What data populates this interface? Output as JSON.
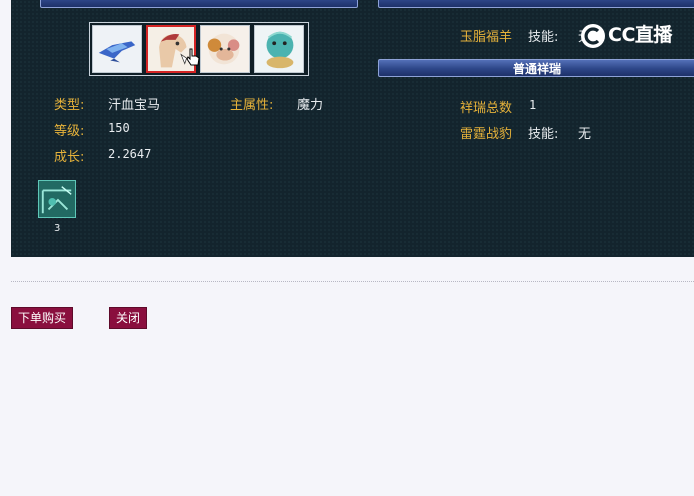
{
  "panels": {
    "top_left_banner": "",
    "top_right_banner": "",
    "normal_banner": "普通祥瑞"
  },
  "pets": [
    {
      "name": "pet-1",
      "selected": false
    },
    {
      "name": "pet-2",
      "selected": true
    },
    {
      "name": "pet-3",
      "selected": false
    },
    {
      "name": "pet-4",
      "selected": false
    }
  ],
  "stats": {
    "type_label": "类型:",
    "type_value": "汗血宝马",
    "attr_label": "主属性:",
    "attr_value": "魔力",
    "level_label": "等级:",
    "level_value": "150",
    "growth_label": "成长:",
    "growth_value": "2.2647"
  },
  "right": {
    "special_name": "玉脂福羊",
    "skill_label": "技能:",
    "special_skill": "无",
    "total_label": "祥瑞总数",
    "total_value": "1",
    "item_name": "雷霆战豹",
    "item_skill_label": "技能:",
    "item_skill": "无"
  },
  "item": {
    "count": "3",
    "icon": "tile-icon"
  },
  "buttons": {
    "buy": "下单购买",
    "close": "关闭"
  },
  "logo_text": "CC直播",
  "colors": {
    "panel": "#13242d",
    "label": "#e6b23a",
    "button": "#8a0f3e"
  }
}
